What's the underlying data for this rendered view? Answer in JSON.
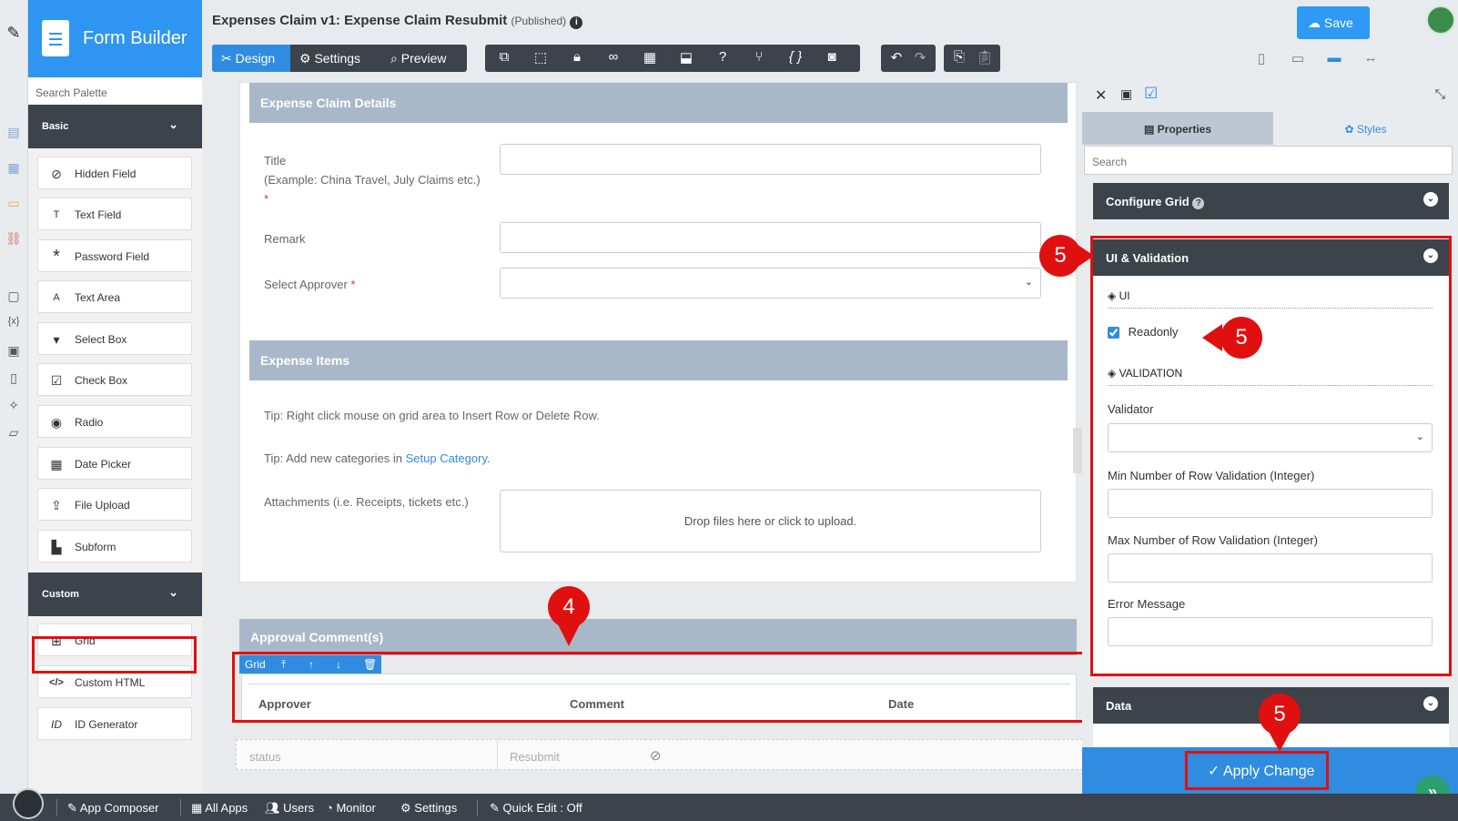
{
  "app": {
    "name": "Form Builder"
  },
  "form": {
    "title": "Expenses Claim v1: Expense Claim Resubmit",
    "status": "(Published)"
  },
  "toolbar": {
    "design": "Design",
    "settings": "Settings",
    "preview": "Preview",
    "save": "Save"
  },
  "palette": {
    "search_placeholder": "Search Palette",
    "basic": "Basic",
    "basic_items": [
      "Hidden Field",
      "Text Field",
      "Password Field",
      "Text Area",
      "Select Box",
      "Check Box",
      "Radio",
      "Date Picker",
      "File Upload",
      "Subform"
    ],
    "custom": "Custom",
    "custom_items": [
      "Grid",
      "Custom HTML",
      "ID Generator"
    ]
  },
  "canvas": {
    "section1": "Expense Claim Details",
    "title_label": "Title",
    "title_example": "(Example: China Travel, July Claims etc.)",
    "required_mark": "*",
    "remark_label": "Remark",
    "approver_label": "Select Approver",
    "section2": "Expense Items",
    "tip1": "Tip: Right click mouse on grid area to Insert Row or Delete Row.",
    "tip2_prefix": "Tip: Add new categories in ",
    "tip2_link": "Setup Category",
    "tip2_suffix": ".",
    "attachments_label": "Attachments (i.e. Receipts, tickets etc.)",
    "upload_text": "Drop files here or click to upload.",
    "section3": "Approval Comment(s)",
    "grid_bar_label": "Grid",
    "grid_columns": [
      "Approver",
      "Comment",
      "Date"
    ],
    "status_label": "status",
    "status_value": "Resubmit"
  },
  "properties": {
    "tab_properties": "Properties",
    "tab_styles": "Styles",
    "search_placeholder": "Search",
    "configure_grid": "Configure Grid",
    "ui_validation": "UI & Validation",
    "ui": "UI",
    "readonly": "Readonly",
    "readonly_checked": true,
    "validation": "VALIDATION",
    "validator": "Validator",
    "min_rows": "Min Number of Row Validation (Integer)",
    "max_rows": "Max Number of Row Validation (Integer)",
    "error_message": "Error Message",
    "data": "Data",
    "apply": "Apply Change"
  },
  "annotations": {
    "step4": "4",
    "step5": "5"
  },
  "footer": {
    "app_composer": "App Composer",
    "all_apps": "All Apps",
    "users": "Users",
    "monitor": "Monitor",
    "settings": "Settings",
    "quick_edit": "Quick Edit : Off"
  },
  "colors": {
    "primary": "#2f8ce0",
    "dark": "#3c434b",
    "highlight": "#e01010",
    "section": "#a9b8c8"
  }
}
